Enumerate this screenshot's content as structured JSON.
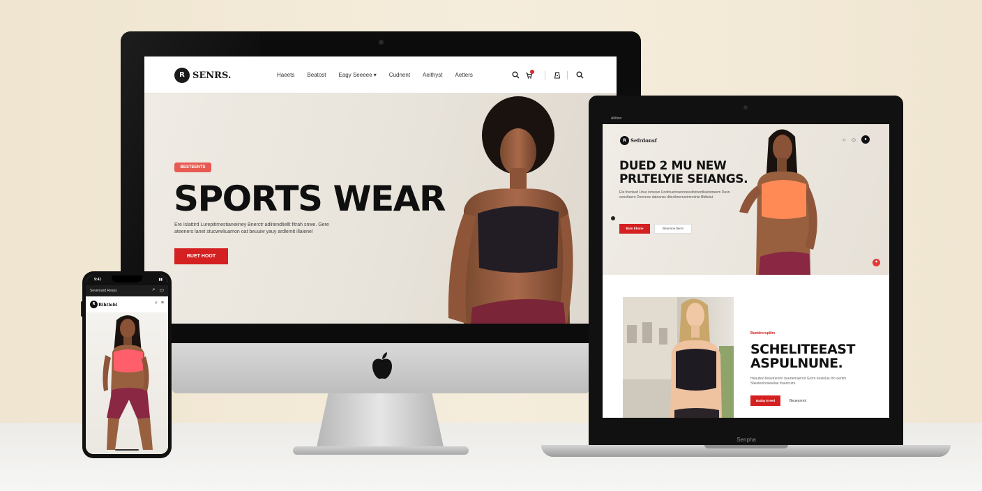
{
  "imac": {
    "brand": "SENRS.",
    "brand_badge": "R",
    "menu": [
      "Haeets",
      "Beatost",
      "Eagy Seeeee",
      "Cudnent",
      "Aeithyst",
      "Aetters"
    ],
    "menu_dropdown": "Eagy Seeeee",
    "nav_icons": [
      "search-icon",
      "cart-icon",
      "bag-icon",
      "search-icon"
    ],
    "badge": "BESTEENTS",
    "title": "SPORTS WEAR",
    "description": "Ere Islattird Lurepitimestianeiiney Bnerctr adiitendtiellt fitrah snwe. Gere ateeners lanet stucwwliuamon oat beuuiw yauy ardlemit illaiene!",
    "cta": "BUET HOOT"
  },
  "laptop": {
    "topbar_left": "Ahltion",
    "topbar_right": "",
    "brand": "Sefrdonsf",
    "title_line1": "DUED 2 MU NEW",
    "title_line2": "PRLTELYIE SEIANGS.",
    "description": "Ete thertasd Ltree iomewn Uoofnuerirsenrnesoihirnentlsietsmeem Dusn eonetlaere Dnnenoe daleanse dtiecilmernerimnolnie Btdteiat",
    "cta": "Bulo Ehone",
    "cta_secondary": "Bennnne tterre",
    "kicker": "Buetdrerepliirs",
    "section_title_line1": "SCHELITEEAST",
    "section_title_line2": "ASPULNUNE.",
    "section_desc": "Heauiled fewemenrin beertemaernd Grom enelelue tho eentm Slieeteoinoweelae fraadcumi.",
    "section_cta": "Baday Ereed",
    "section_link": "Beueunnot",
    "label": "Senpha"
  },
  "phone": {
    "time": "9:41",
    "url": "Severnard Reass",
    "brand": "Bihtlebl",
    "brand_badge": "R"
  },
  "colors": {
    "accent": "#d42020",
    "badge": "#e8574f",
    "dark": "#111111"
  }
}
